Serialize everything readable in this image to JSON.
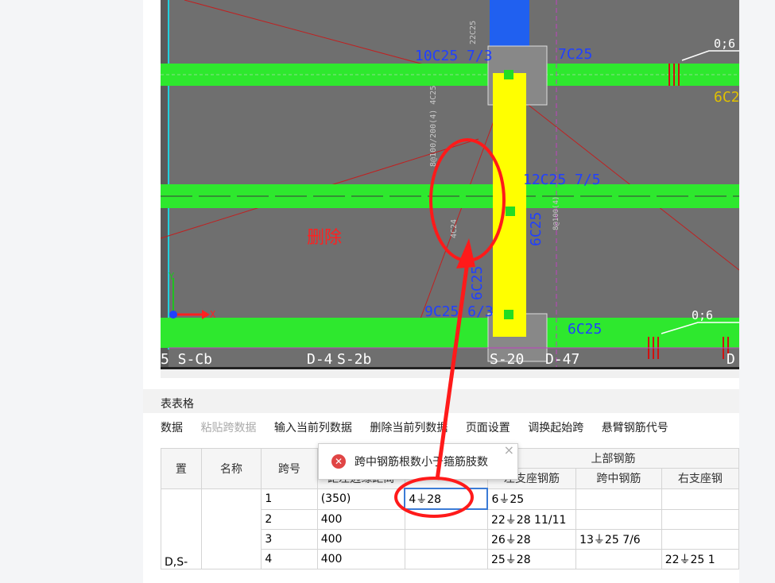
{
  "cad": {
    "labels": {
      "top_left_rebar": "10C25 7/3",
      "top_mid_rebar": "7C25",
      "top_right_rebar": "0;6",
      "right_partial": "6C2",
      "col_right_rebar": "12C25 7/5",
      "vertical_rebar": "6C25",
      "vertical_small": "6C25",
      "bottom_left_rebar": "9C25 6/3",
      "bottom_mid_rebar": "6C25",
      "bottom_right_rebar": "0;6",
      "delete_annotation": "删除",
      "beam_label_1": "5 S-Cb",
      "beam_label_2": "D-4",
      "beam_label_3": "S-2b",
      "beam_label_4": "S-20",
      "beam_label_5": "D-47",
      "beam_label_6": "D",
      "axis_y": "Y",
      "axis_x": "X",
      "faint_vertical_1": "22C25",
      "faint_vertical_2": "8@100/200(4) 4C25",
      "faint_vertical_3": "4C24",
      "faint_vertical_4": "8@100(4)"
    }
  },
  "panel": {
    "title": "表表格",
    "toolbar": [
      "数据",
      "粘贴跨数据",
      "输入当前列数据",
      "删除当前列数据",
      "页面设置",
      "调换起始跨",
      "悬臂钢筋代号"
    ]
  },
  "table": {
    "headers_top": [
      "置",
      "名称",
      "跨号",
      "",
      "",
      "上部钢筋"
    ],
    "headers_sub": [
      "距左边缘距离",
      "",
      "左支座钢筋",
      "跨中钢筋",
      "右支座钢"
    ],
    "rows": [
      {
        "span": "1",
        "dist": "(350)",
        "mid": "4⏚28",
        "left": "6⏚25",
        "mid2": "",
        "right": ""
      },
      {
        "span": "2",
        "dist": "400",
        "mid": "",
        "left": "22⏚28 11/11",
        "mid2": "",
        "right": ""
      },
      {
        "span": "3",
        "dist": "400",
        "mid": "",
        "left": "26⏚28",
        "mid2": "13⏚25 7/6",
        "right": ""
      },
      {
        "span": "4",
        "dist": "400",
        "mid": "",
        "left": "25⏚28",
        "mid2": "",
        "right": "22⏚25 1"
      }
    ],
    "position_cell": "D,S-"
  },
  "tooltip": {
    "message": "跨中钢筋根数小于箍筋肢数",
    "close": "×"
  },
  "colors": {
    "cad_bg": "#6f6f6f",
    "beam_green": "#2ee82e",
    "column_yellow": "#ffff00",
    "annotation_red": "#ff2020",
    "rebar_blue": "#2040ff"
  }
}
